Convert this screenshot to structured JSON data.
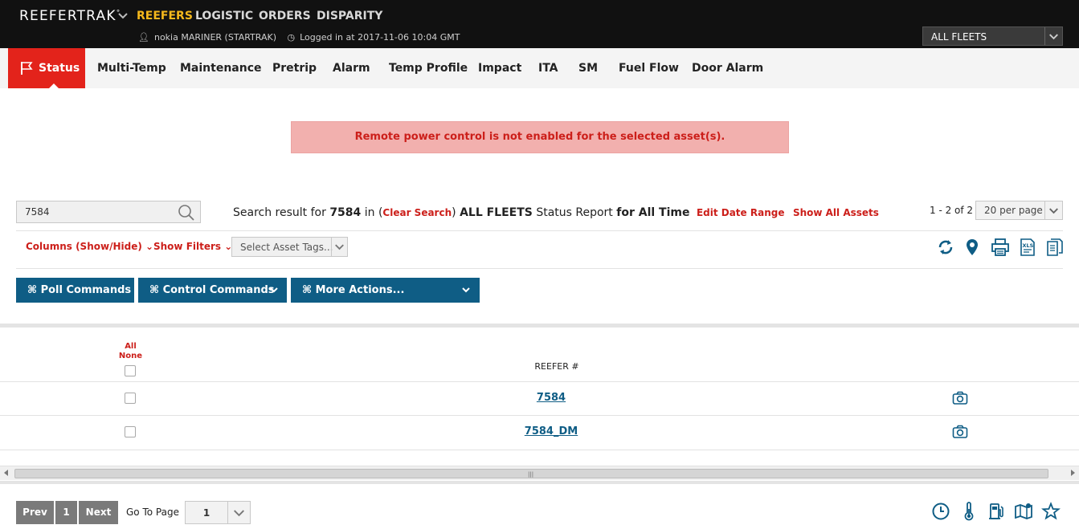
{
  "header": {
    "brand": "REEFERTRAK",
    "brand_mark": "°",
    "nav": [
      "REEFERS",
      "LOGISTIC",
      "ORDERS",
      "DISPARITY"
    ],
    "active_nav": "REEFERS",
    "user": "nokia MARINER (STARTRAK)",
    "login": "Logged in at 2017-11-06 10:04 GMT",
    "fleet_select": "ALL FLEETS"
  },
  "tabs": [
    "Status",
    "Multi-Temp",
    "Maintenance",
    "Pretrip",
    "Alarm",
    "Temp Profile",
    "Impact",
    "ITA",
    "SM",
    "Fuel Flow",
    "Door Alarm"
  ],
  "active_tab": "Status",
  "alert": "Remote power control is not enabled for the selected asset(s).",
  "search": {
    "value": "7584",
    "result_prefix": "Search result for",
    "term": "7584",
    "in_text": "in (",
    "clear_search": "Clear Search",
    "close_paren": ")",
    "fleet": "ALL FLEETS",
    "report": "Status Report",
    "period": "for All Time",
    "edit_date": "Edit Date Range",
    "show_all": "Show All Assets"
  },
  "pagination_top": {
    "count": "1 - 2 of 2",
    "per_page": "20 per page"
  },
  "filters": {
    "columns": "Columns (Show/Hide)",
    "show_filters": "Show Filters",
    "tags_placeholder": "Select Asset Tags..."
  },
  "actions": {
    "poll": "⌘ Poll Commands",
    "control": "⌘ Control Commands",
    "more": "⌘ More Actions..."
  },
  "table": {
    "all": "All",
    "none": "None",
    "column_header": "REEFER #",
    "rows": [
      {
        "reefer": "7584"
      },
      {
        "reefer": "7584_DM"
      }
    ]
  },
  "pagination_bottom": {
    "prev": "Prev",
    "page": "1",
    "next": "Next",
    "goto_label": "Go To Page",
    "goto_value": "1"
  },
  "colors": {
    "header_bg": "#111111",
    "active_nav": "#f5b81c",
    "active_tab": "#e3231b",
    "alert_bg": "#f2b0ae",
    "link_red": "#cc1f1a",
    "action_blue": "#0f5d85"
  },
  "icons": [
    "search-icon",
    "refresh-icon",
    "map-pin-icon",
    "printer-icon",
    "xls-export-icon",
    "pdf-export-icon",
    "camera-icon",
    "clock-icon",
    "thermometer-icon",
    "fuel-icon",
    "map-icon",
    "star-icon",
    "flag-icon",
    "user-icon"
  ]
}
